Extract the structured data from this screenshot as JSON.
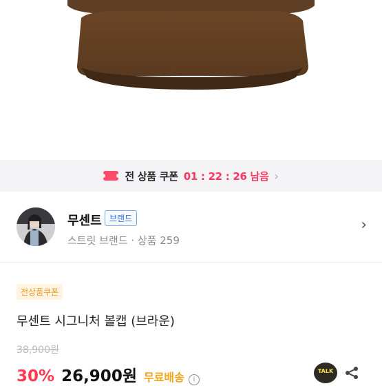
{
  "colors": {
    "accent_red": "#ff3560",
    "brand_blue": "#2f6fd6",
    "shipping_orange": "#f3a51b",
    "cap_brown": "#6e4a2c"
  },
  "coupon_banner": {
    "label": "전 상품 쿠폰",
    "timer": "01 : 22 : 26 남음"
  },
  "store": {
    "name": "무센트",
    "badge": "브랜드",
    "meta": "스트릿 브랜드 · 상품 259"
  },
  "product": {
    "tag": "전상품쿠폰",
    "title": "무센트 시그니처 볼캡 (브라운)",
    "original_price": "38,900원",
    "discount": "30%",
    "price": "26,900원",
    "shipping": "무료배송"
  },
  "actions": {
    "talk_label": "TALK"
  }
}
